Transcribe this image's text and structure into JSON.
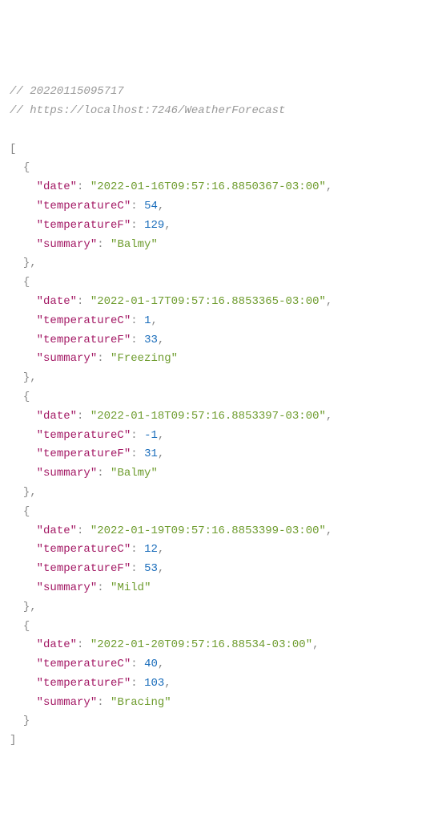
{
  "comment_line1": "// 20220115095717",
  "comment_line2": "// https://localhost:7246/WeatherForecast",
  "open_bracket": "[",
  "close_bracket": "]",
  "open_brace": "{",
  "close_brace": "}",
  "close_brace_comma": "},",
  "colon": ":",
  "comma": ",",
  "quote": "\"",
  "indent1": "  ",
  "indent2": "    ",
  "keys": {
    "date": "date",
    "temperatureC": "temperatureC",
    "temperatureF": "temperatureF",
    "summary": "summary"
  },
  "items": [
    {
      "date": "2022-01-16T09:57:16.8850367-03:00",
      "temperatureC": "54",
      "temperatureF": "129",
      "summary": "Balmy"
    },
    {
      "date": "2022-01-17T09:57:16.8853365-03:00",
      "temperatureC": "1",
      "temperatureF": "33",
      "summary": "Freezing"
    },
    {
      "date": "2022-01-18T09:57:16.8853397-03:00",
      "temperatureC": "-1",
      "temperatureF": "31",
      "summary": "Balmy"
    },
    {
      "date": "2022-01-19T09:57:16.8853399-03:00",
      "temperatureC": "12",
      "temperatureF": "53",
      "summary": "Mild"
    },
    {
      "date": "2022-01-20T09:57:16.88534-03:00",
      "temperatureC": "40",
      "temperatureF": "103",
      "summary": "Bracing"
    }
  ]
}
